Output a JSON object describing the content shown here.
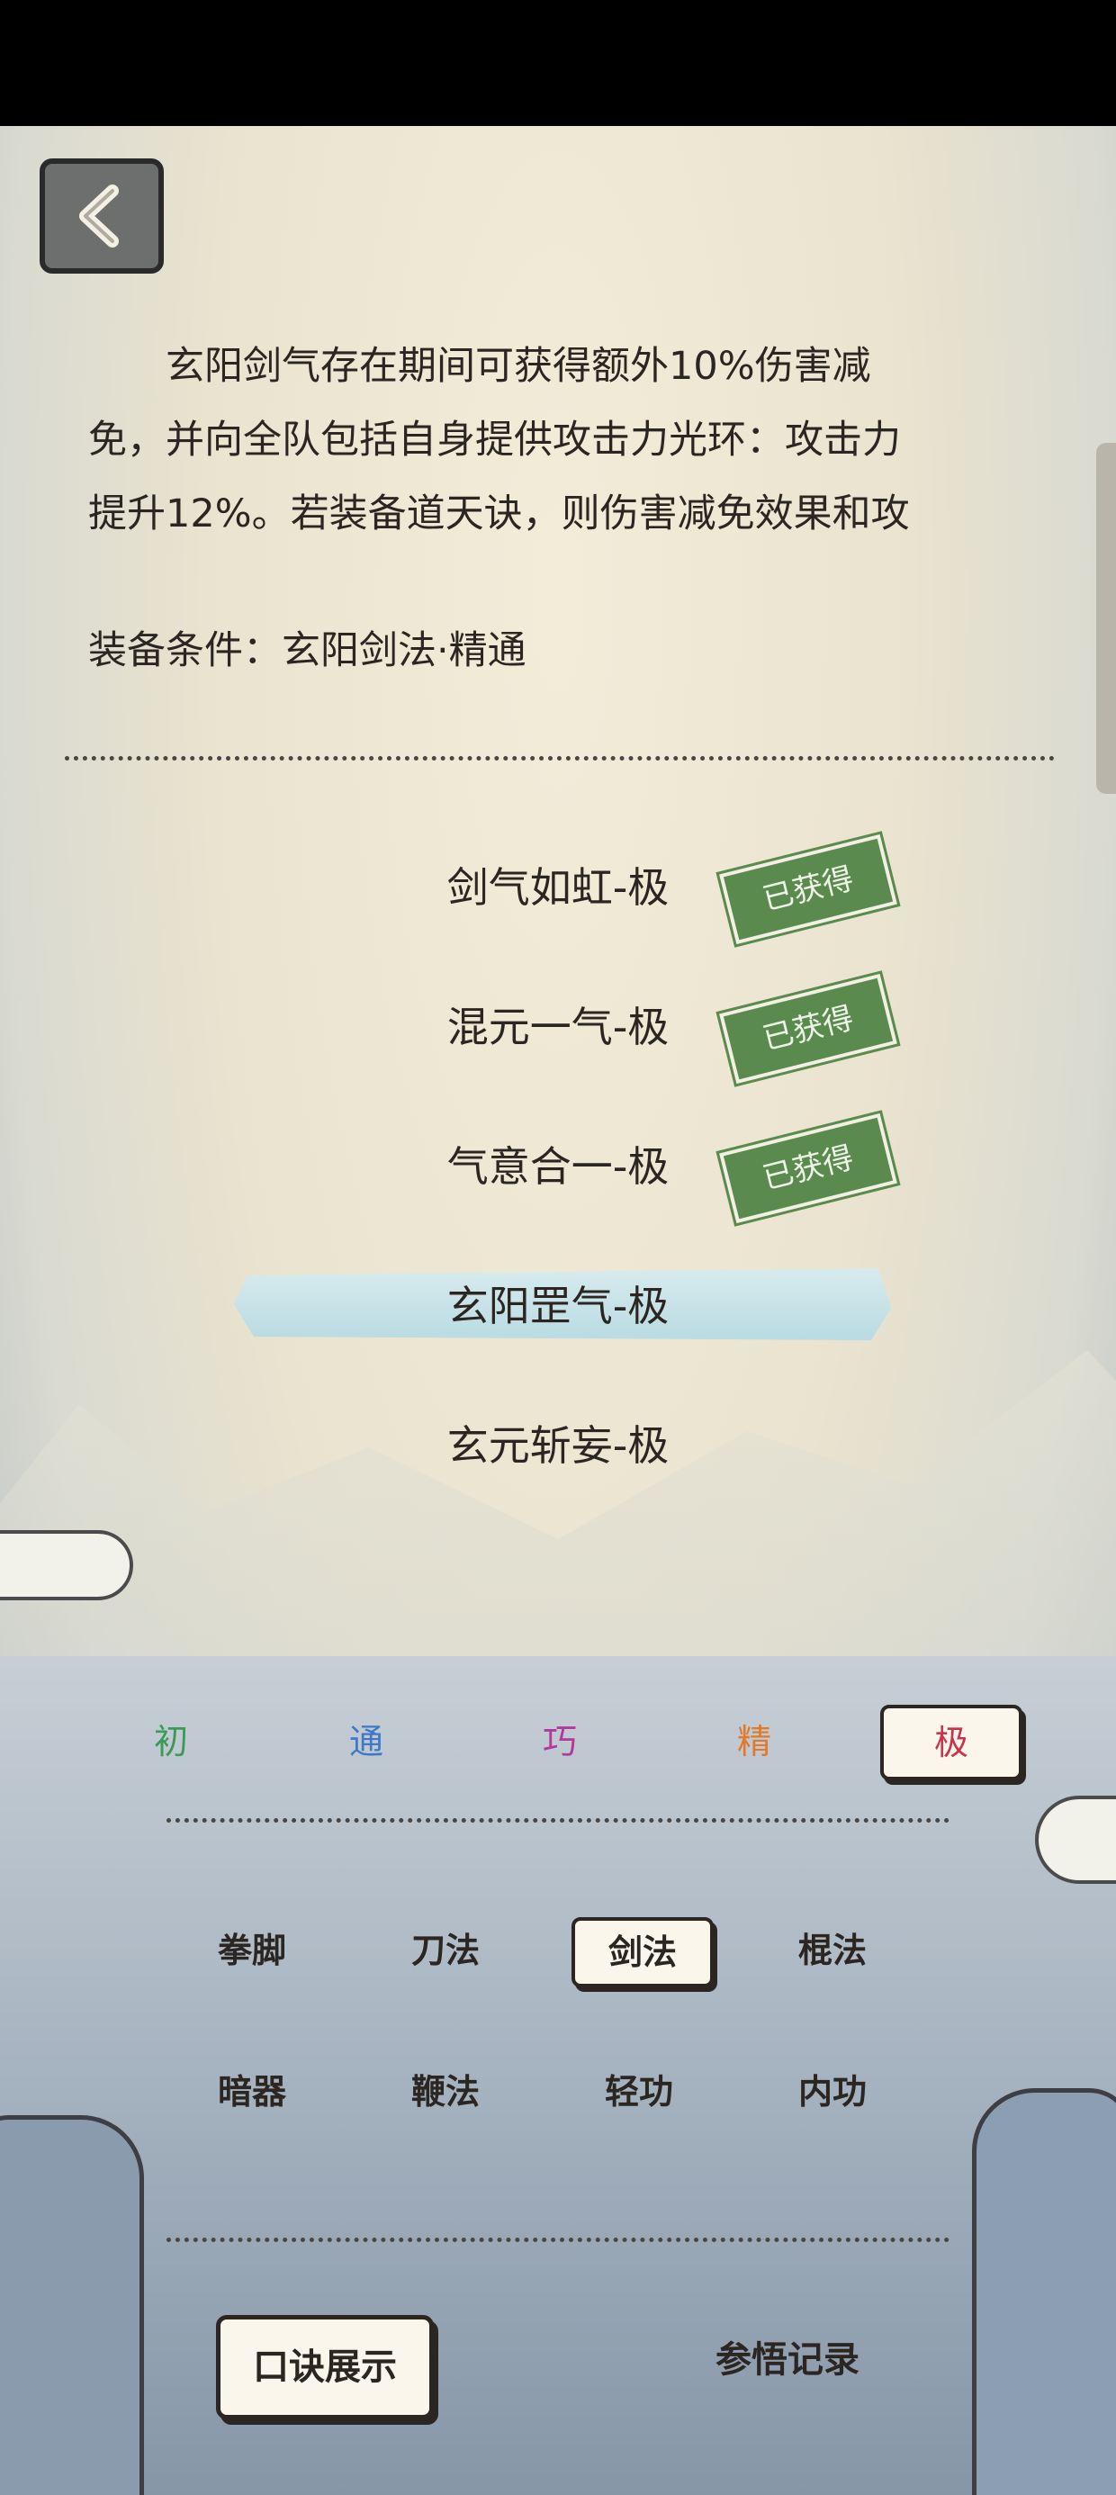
{
  "description": [
    "　　玄阳剑气存在期间可获得额外10%伤害减",
    "免，并向全队包括自身提供攻击力光环：攻击力",
    "提升12%。若装备道天诀，则伤害减免效果和攻"
  ],
  "condition": "装备条件：玄阳剑法·精通",
  "skills": [
    {
      "name": "剑气如虹-极",
      "stamp": "已获得"
    },
    {
      "name": "混元一气-极",
      "stamp": "已获得"
    },
    {
      "name": "气意合一-极",
      "stamp": "已获得"
    },
    {
      "name": "玄阳罡气-极",
      "selected": true
    },
    {
      "name": "玄元斩妄-极"
    }
  ],
  "grades": [
    {
      "label": "初",
      "color": "#3b9a57"
    },
    {
      "label": "通",
      "color": "#3f78c8"
    },
    {
      "label": "巧",
      "color": "#b23a9c"
    },
    {
      "label": "精",
      "color": "#e07a2a"
    },
    {
      "label": "极",
      "color": "#c8344a",
      "active": true
    }
  ],
  "categories": {
    "row1": [
      "拳脚",
      "刀法",
      "剑法",
      "棍法"
    ],
    "row2": [
      "暗器",
      "鞭法",
      "轻功",
      "内功"
    ],
    "active": "剑法"
  },
  "bottom": {
    "show_button": "口诀展示",
    "record_button": "参悟记录"
  },
  "icons": {
    "back": "back-arrow-icon"
  }
}
